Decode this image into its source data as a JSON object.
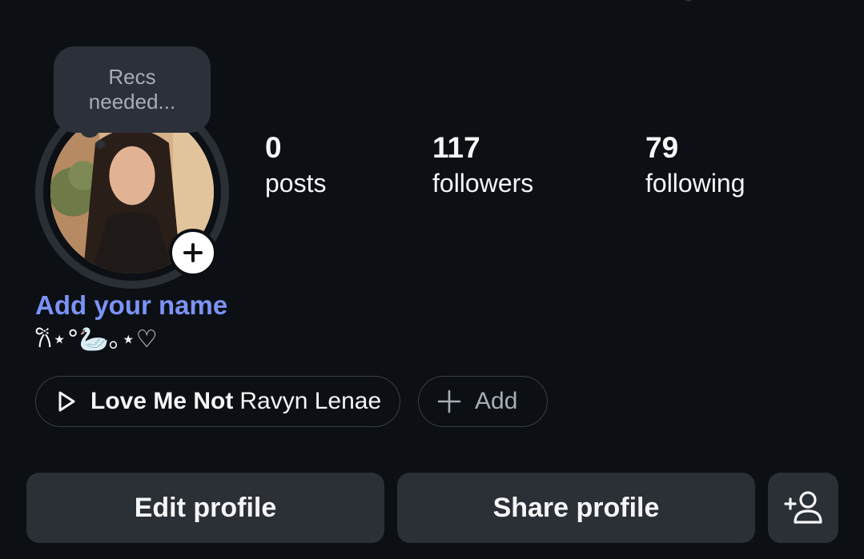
{
  "note": {
    "text": "Recs needed..."
  },
  "stats": [
    {
      "count": "0",
      "label": "posts"
    },
    {
      "count": "117",
      "label": "followers"
    },
    {
      "count": "79",
      "label": "following"
    }
  ],
  "profile": {
    "name_prompt": "Add your name",
    "bio": "𐙚⋆°🦢｡⋆♡"
  },
  "music": {
    "title": "Love Me Not",
    "artist": "Ravyn Lenae"
  },
  "add_chip": {
    "label": "Add"
  },
  "buttons": {
    "edit": "Edit profile",
    "share": "Share profile"
  },
  "icons": {
    "play": "play-icon",
    "plus": "plus-icon",
    "add_story": "add-story-plus-icon",
    "add_person": "add-person-icon"
  },
  "colors": {
    "accent": "#7b93f5",
    "background": "#0c0f14",
    "button": "#2b2f36"
  }
}
